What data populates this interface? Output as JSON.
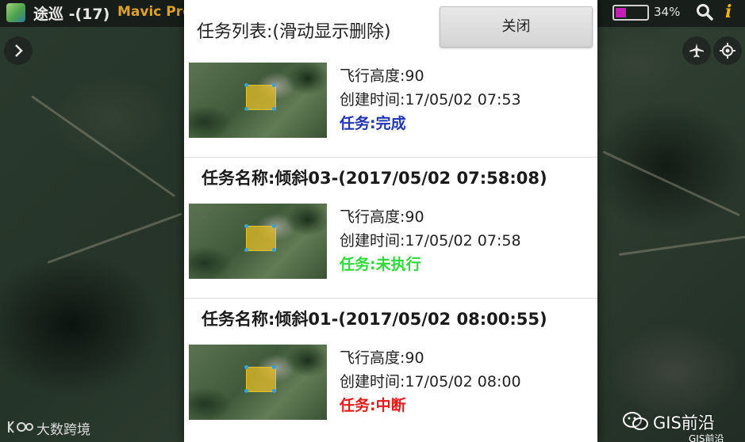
{
  "topbar": {
    "app_title": "途巡 -(17)",
    "drone_model": "Mavic Pro",
    "battery_percent_text": "34%",
    "battery_level": 0.34,
    "battery_color": "#c21fb5"
  },
  "dialog": {
    "title": "任务列表:(滑动显示删除)",
    "close_label": "关闭"
  },
  "tasks": [
    {
      "name": "",
      "altitude": "飞行高度:90",
      "created": "创建时间:17/05/02 07:53",
      "status": "任务:完成",
      "status_color": "#2236b3"
    },
    {
      "name": "任务名称:倾斜03-(2017/05/02 07:58:08)",
      "altitude": "飞行高度:90",
      "created": "创建时间:17/05/02 07:58",
      "status": "任务:未执行",
      "status_color": "#2fd93a"
    },
    {
      "name": "任务名称:倾斜01-(2017/05/02 08:00:55)",
      "altitude": "飞行高度:90",
      "created": "创建时间:17/05/02 08:00",
      "status": "任务:中断",
      "status_color": "#e21b1b"
    }
  ],
  "watermarks": {
    "left": "大数跨境",
    "right": "GIS前沿",
    "right_small": "GIS前沿"
  },
  "icons": {
    "app_logo": "app-logo-icon",
    "search": "search-icon",
    "info": "info-icon",
    "expand": "chevron-right-icon",
    "aircraft": "airplane-icon",
    "locate": "locate-icon"
  }
}
